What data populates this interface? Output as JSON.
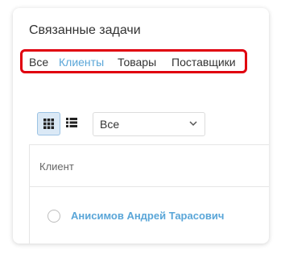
{
  "card": {
    "title": "Связанные задачи"
  },
  "tabs": [
    {
      "label": "Все",
      "active": false
    },
    {
      "label": "Клиенты",
      "active": true
    },
    {
      "label": "Товары",
      "active": false
    },
    {
      "label": "Поставщики",
      "active": false
    }
  ],
  "toolbar": {
    "view_modes": [
      "grid-icon",
      "list-icon"
    ],
    "active_view": "grid",
    "filter_value": "Все"
  },
  "table": {
    "column_header": "Клиент",
    "rows": [
      {
        "client": "Анисимов Андрей Тарасович",
        "selected": false
      }
    ]
  },
  "colors": {
    "accent": "#5aa6d8",
    "highlight_border": "#e0000f",
    "active_view_bg": "#dbe9f6"
  }
}
